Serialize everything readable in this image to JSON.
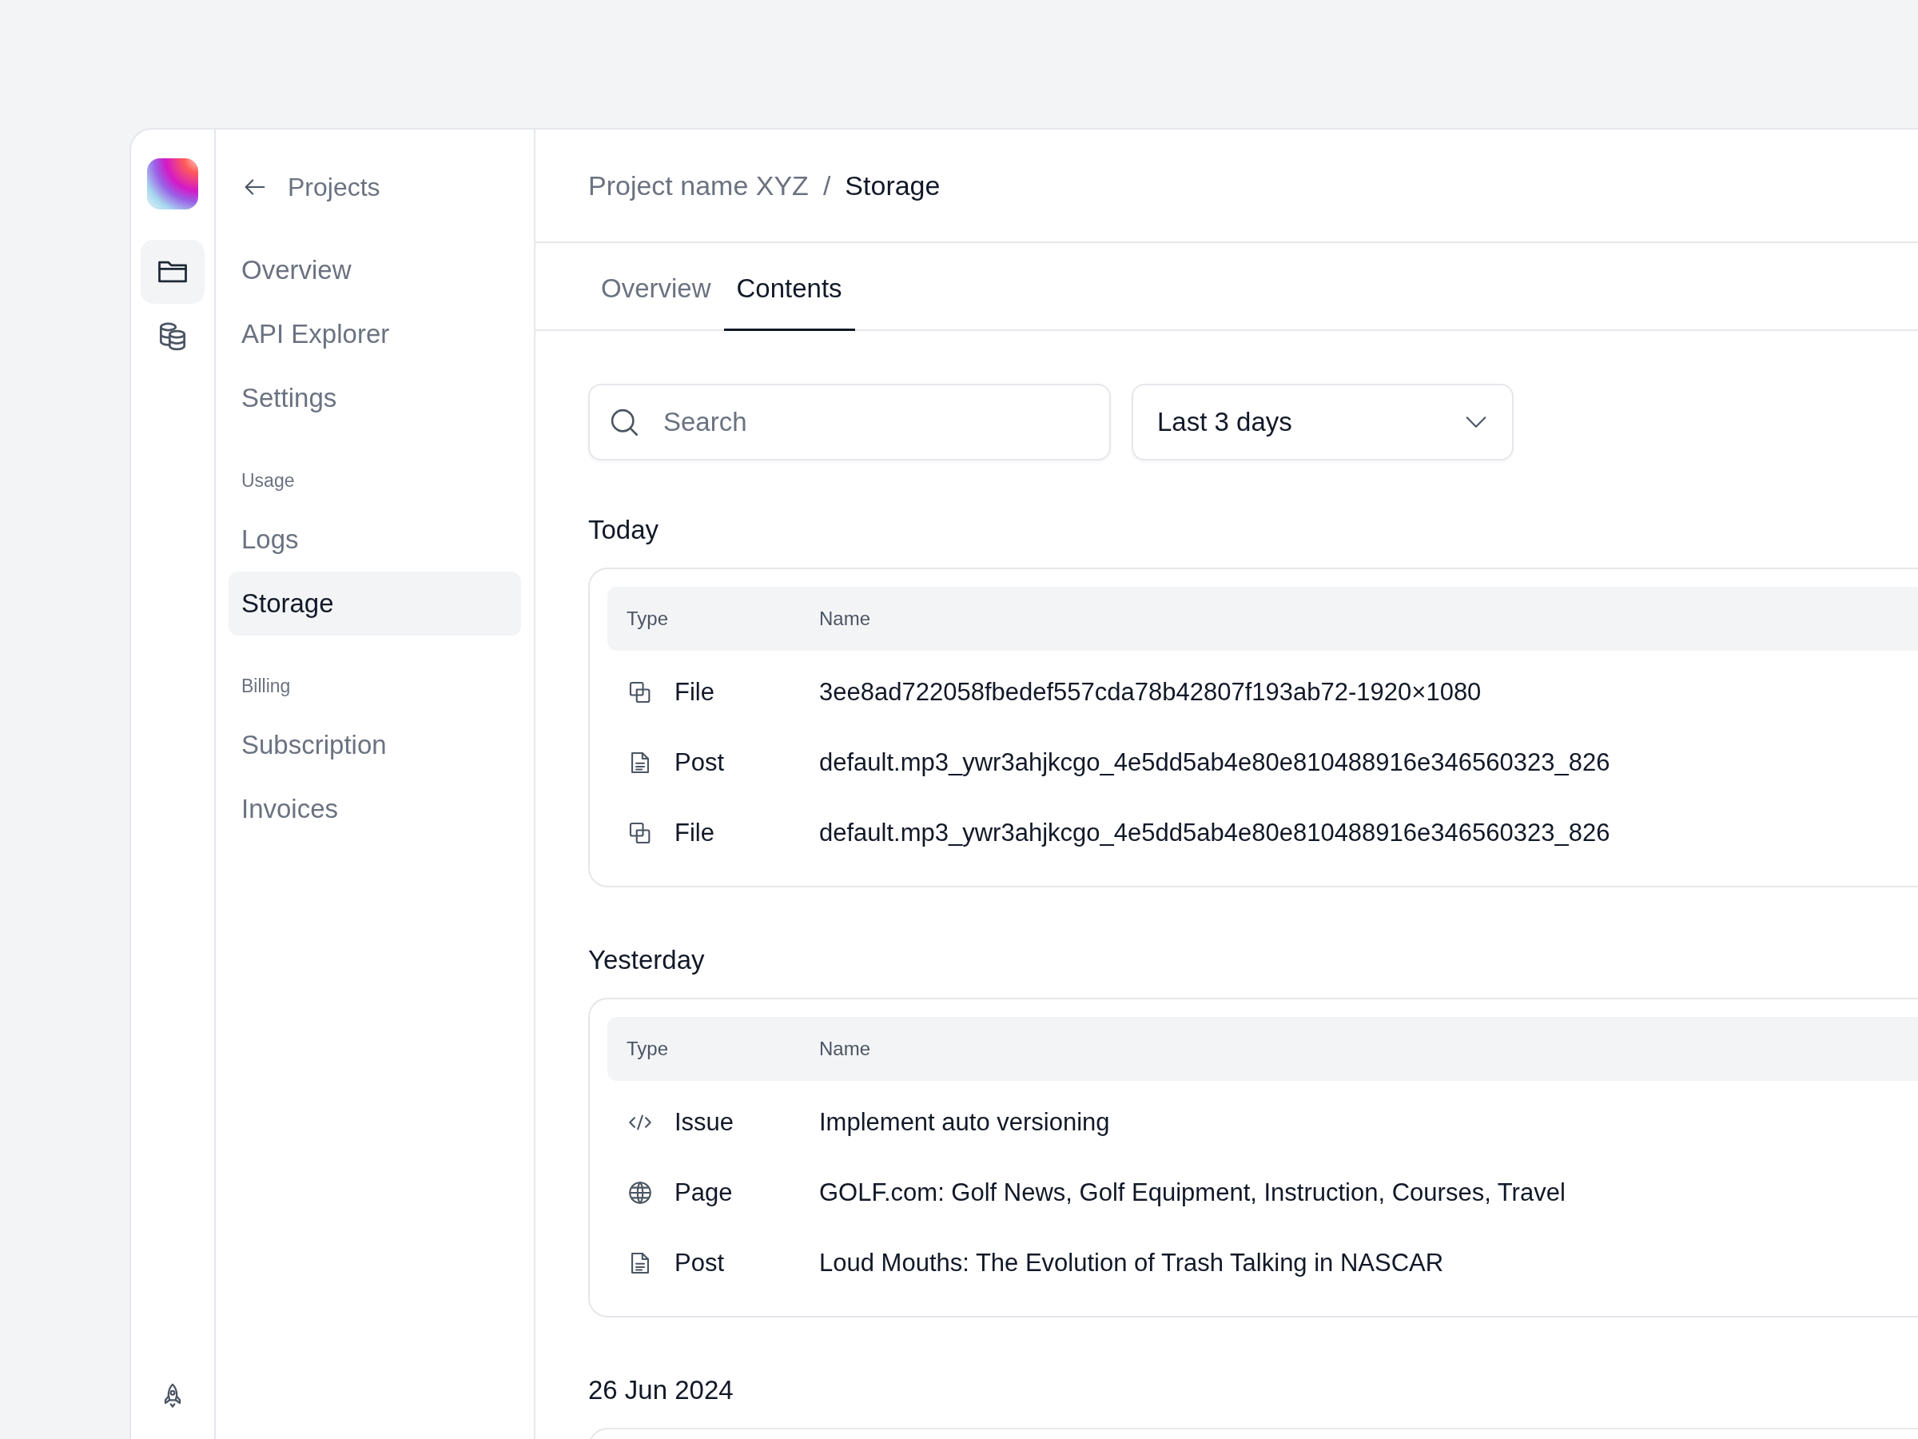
{
  "rail": {
    "items": [
      {
        "kind": "folder",
        "selected": true
      },
      {
        "kind": "database",
        "selected": false
      }
    ]
  },
  "sidebar": {
    "back": "Projects",
    "groups": [
      {
        "items": [
          {
            "label": "Overview",
            "selected": false
          },
          {
            "label": "API Explorer",
            "selected": false
          },
          {
            "label": "Settings",
            "selected": false
          }
        ]
      },
      {
        "title": "Usage",
        "items": [
          {
            "label": "Logs",
            "selected": false
          },
          {
            "label": "Storage",
            "selected": true
          }
        ]
      },
      {
        "title": "Billing",
        "items": [
          {
            "label": "Subscription",
            "selected": false
          },
          {
            "label": "Invoices",
            "selected": false
          }
        ]
      }
    ]
  },
  "breadcrumb": {
    "parent": "Project name XYZ",
    "separator": "/",
    "current": "Storage"
  },
  "tabs": [
    {
      "label": "Overview",
      "selected": false
    },
    {
      "label": "Contents",
      "selected": true
    }
  ],
  "search": {
    "placeholder": "Search"
  },
  "range": {
    "value": "Last 3 days"
  },
  "sections": [
    {
      "heading": "Today",
      "columns": [
        "Type",
        "Name"
      ],
      "rows": [
        {
          "kind": "file",
          "type": "File",
          "name": "3ee8ad722058fbedef557cda78b42807f193ab72-1920×1080"
        },
        {
          "kind": "post",
          "type": "Post",
          "name": "default.mp3_ywr3ahjkcgo_4e5dd5ab4e80e810488916e346560323_826"
        },
        {
          "kind": "file",
          "type": "File",
          "name": "default.mp3_ywr3ahjkcgo_4e5dd5ab4e80e810488916e346560323_826"
        }
      ]
    },
    {
      "heading": "Yesterday",
      "columns": [
        "Type",
        "Name"
      ],
      "rows": [
        {
          "kind": "issue",
          "type": "Issue",
          "name": "Implement auto versioning"
        },
        {
          "kind": "page",
          "type": "Page",
          "name": "GOLF.com: Golf News, Golf Equipment, Instruction, Courses, Travel"
        },
        {
          "kind": "post",
          "type": "Post",
          "name": "Loud Mouths: The Evolution of Trash Talking in NASCAR"
        }
      ]
    },
    {
      "heading": "26 Jun 2024"
    }
  ]
}
